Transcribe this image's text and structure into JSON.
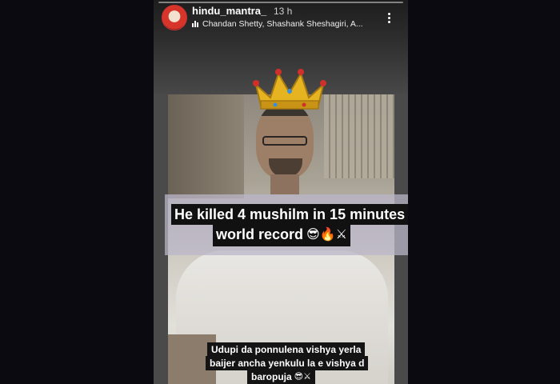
{
  "story": {
    "user": {
      "username": "hindu_mantra_",
      "time": "13 h",
      "tagged": "Chandan Shetty, Shashank Sheshagiri, A..."
    },
    "caption": {
      "line1": "He killed 4 mushilm in 15 minutes",
      "line2": "world record",
      "line2_emojis": "😎🔥⚔"
    },
    "subtitle": {
      "line1": "Udupi da ponnulena vishya yerla",
      "line2": "baijer ancha yenkulu la e vishya d",
      "line3": "baropuja",
      "line3_emojis": "😎⚔"
    }
  },
  "icons": {
    "menu": "more-vertical-icon",
    "music": "audio-bars-icon",
    "crown": "crown-icon"
  },
  "colors": {
    "background": "#0a0a10",
    "caption_bg": "#111111",
    "caption_band": "#b9b6c8",
    "username": "#ffffff"
  }
}
